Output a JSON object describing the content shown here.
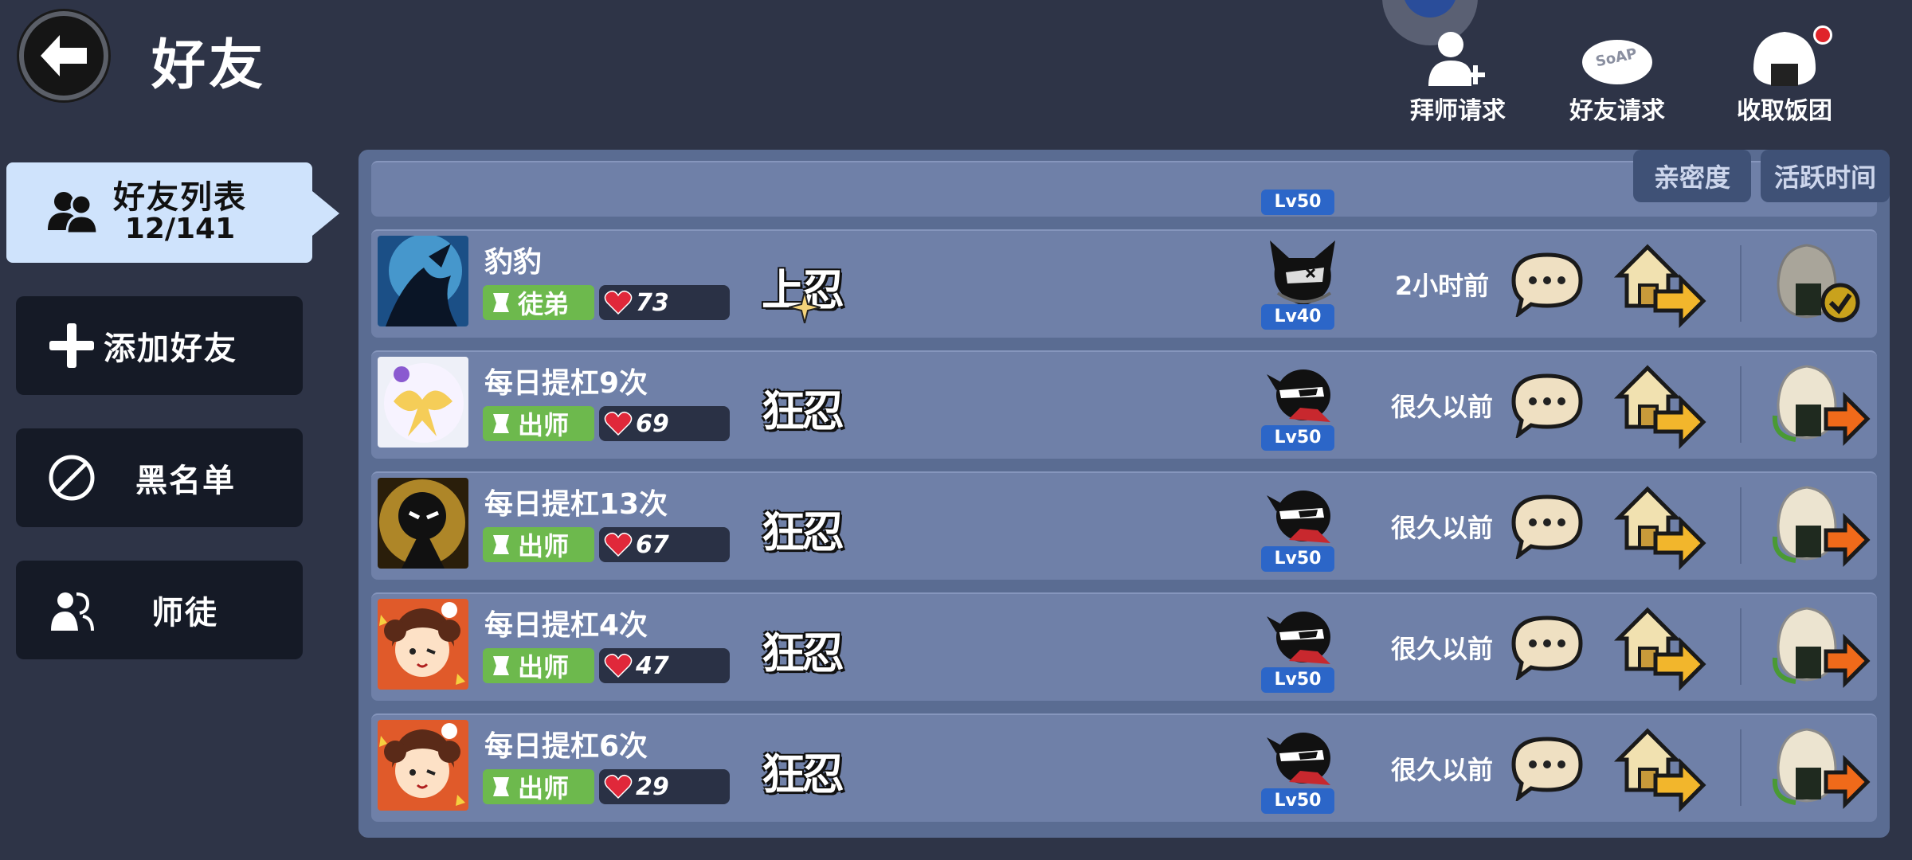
{
  "header": {
    "title": "好友",
    "actions": [
      {
        "id": "mentor",
        "label": "拜师请求"
      },
      {
        "id": "friend",
        "label": "好友请求"
      },
      {
        "id": "riceball",
        "label": "收取饭团"
      }
    ],
    "riceball_badge_color": "#e0242a"
  },
  "sidebar": {
    "active": {
      "label": "好友列表",
      "count": "12/141"
    },
    "items": [
      {
        "id": "add",
        "label": "添加好友",
        "icon": "plus-icon"
      },
      {
        "id": "blacklist",
        "label": "黑名单",
        "icon": "ban-icon"
      },
      {
        "id": "mentorship",
        "label": "师徒",
        "icon": "people-icon"
      }
    ]
  },
  "sort": {
    "intimacy": "亲密度",
    "active_time": "活跃时间"
  },
  "friends": [
    {
      "name": "豹豹",
      "tag": "徒弟",
      "hearts": "73",
      "rank": "上忍",
      "level": "Lv40",
      "last_active": "2小时前",
      "avatar": "shadow-blue",
      "gift_sent": true
    },
    {
      "name": "每日提杠9次",
      "tag": "出师",
      "hearts": "69",
      "rank": "狂忍",
      "level": "Lv50",
      "last_active": "很久以前",
      "avatar": "bow-white",
      "gift_sent": false
    },
    {
      "name": "每日提杠13次",
      "tag": "出师",
      "hearts": "67",
      "rank": "狂忍",
      "level": "Lv50",
      "last_active": "很久以前",
      "avatar": "stickman-gold",
      "gift_sent": false
    },
    {
      "name": "每日提杠4次",
      "tag": "出师",
      "hearts": "47",
      "rank": "狂忍",
      "level": "Lv50",
      "last_active": "很久以前",
      "avatar": "anime-girl",
      "gift_sent": false
    },
    {
      "name": "每日提杠6次",
      "tag": "出师",
      "hearts": "29",
      "rank": "狂忍",
      "level": "Lv50",
      "last_active": "很久以前",
      "avatar": "anime-girl",
      "gift_sent": false
    }
  ],
  "partial_row": {
    "level": "Lv50"
  },
  "colors": {
    "background": "#2e3447",
    "panel": "#5a6c92",
    "row": "#6f80a8",
    "tag_green": "#6db94d",
    "level_blue": "#2c66c8",
    "heart_red": "#e0283a"
  }
}
